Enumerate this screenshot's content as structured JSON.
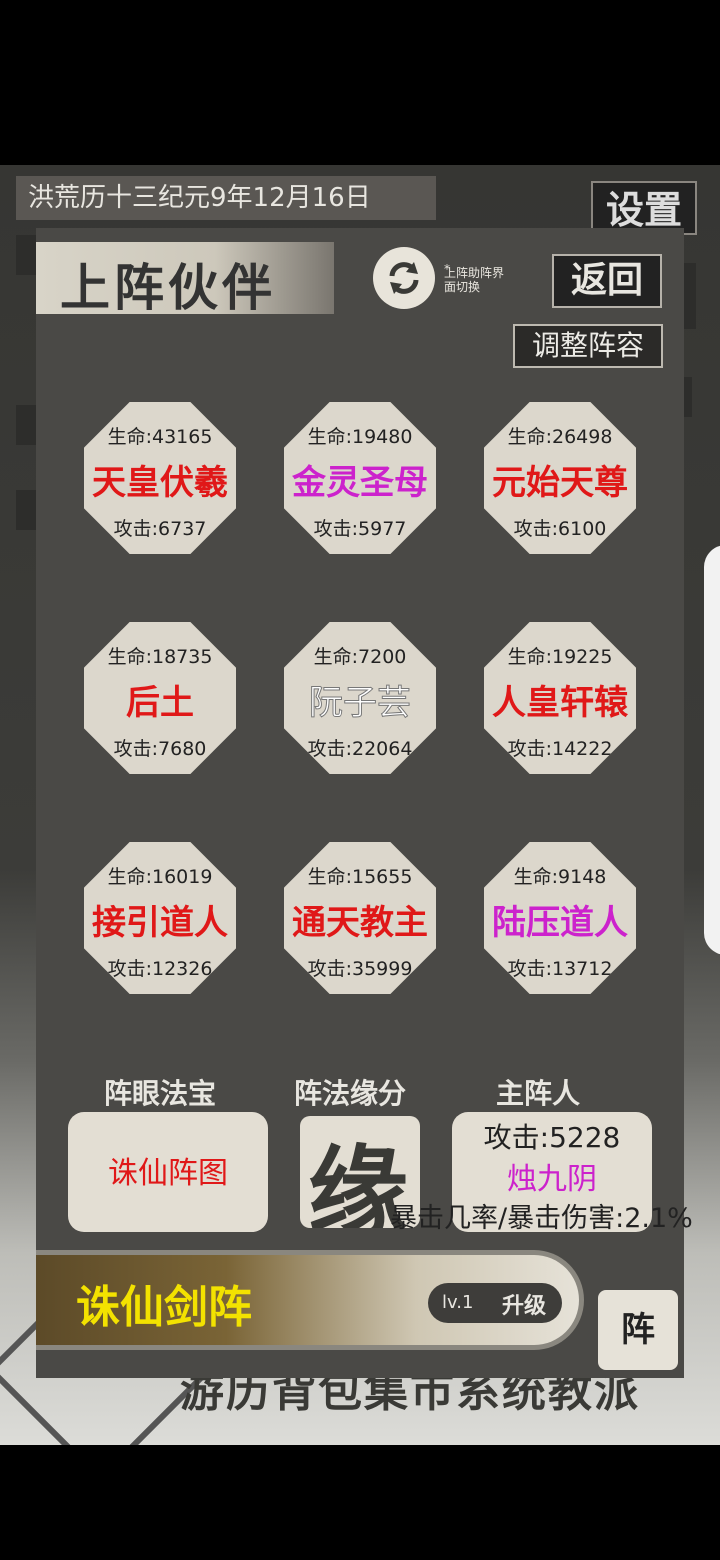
{
  "header": {
    "date": "洪荒历十三纪元9年12月16日",
    "settings_label": "设置"
  },
  "panel": {
    "title": "上阵伙伴",
    "switch_hint_star": "*",
    "switch_hint": "上阵助阵界面切换",
    "back_label": "返回",
    "adjust_label": "调整阵容"
  },
  "partners": [
    {
      "hp": "生命:43165",
      "name": "天皇伏羲",
      "atk": "攻击:6737",
      "color": "#e01818"
    },
    {
      "hp": "生命:19480",
      "name": "金灵圣母",
      "atk": "攻击:5977",
      "color": "#cc22cc"
    },
    {
      "hp": "生命:26498",
      "name": "元始天尊",
      "atk": "攻击:6100",
      "color": "#e01818"
    },
    {
      "hp": "生命:18735",
      "name": "后土",
      "atk": "攻击:7680",
      "color": "#e01818"
    },
    {
      "hp": "生命:7200",
      "name": "阮子芸",
      "atk": "攻击:22064",
      "color": "#ffffff"
    },
    {
      "hp": "生命:19225",
      "name": "人皇轩辕",
      "atk": "攻击:14222",
      "color": "#e01818"
    },
    {
      "hp": "生命:16019",
      "name": "接引道人",
      "atk": "攻击:12326",
      "color": "#e01818"
    },
    {
      "hp": "生命:15655",
      "name": "通天教主",
      "atk": "攻击:35999",
      "color": "#e01818"
    },
    {
      "hp": "生命:9148",
      "name": "陆压道人",
      "atk": "攻击:13712",
      "color": "#cc22cc"
    }
  ],
  "sections": {
    "treasure_label": "阵眼法宝",
    "treasure_value": "诛仙阵图",
    "fate_label": "阵法缘分",
    "fate_char": "缘",
    "main_label": "主阵人",
    "main_atk": "攻击:5228",
    "main_name": "烛九阴",
    "crit": "暴击几率/暴击伤害:2.1%"
  },
  "formation": {
    "name": "诛仙剑阵",
    "level": "lv.1",
    "upgrade_label": "升级",
    "zhen_label": "阵"
  },
  "bottom_nav": {
    "tabs": "游历背包集市系统教派"
  }
}
